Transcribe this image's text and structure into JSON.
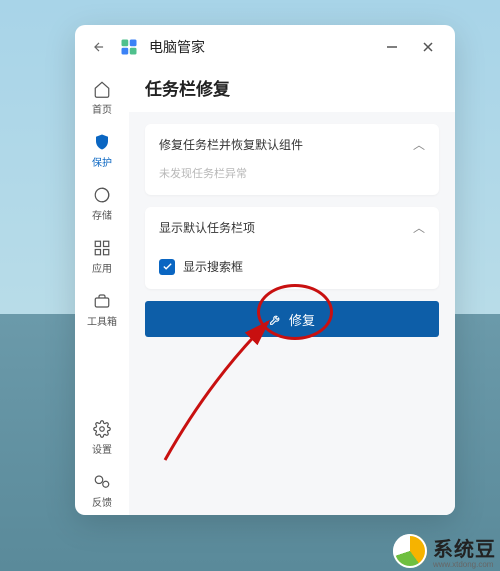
{
  "app": {
    "title": "电脑管家"
  },
  "sidebar": {
    "items": [
      {
        "label": "首页"
      },
      {
        "label": "保护"
      },
      {
        "label": "存储"
      },
      {
        "label": "应用"
      },
      {
        "label": "工具箱"
      }
    ],
    "bottom": [
      {
        "label": "设置"
      },
      {
        "label": "反馈"
      }
    ]
  },
  "page": {
    "title": "任务栏修复",
    "card1": {
      "title": "修复任务栏并恢复默认组件",
      "status": "未发现任务栏异常"
    },
    "card2": {
      "title": "显示默认任务栏项",
      "checkbox_label": "显示搜索框",
      "checked": true
    },
    "action_label": "修复"
  },
  "watermark": {
    "name": "系统豆",
    "url": "www.xtdong.com"
  }
}
